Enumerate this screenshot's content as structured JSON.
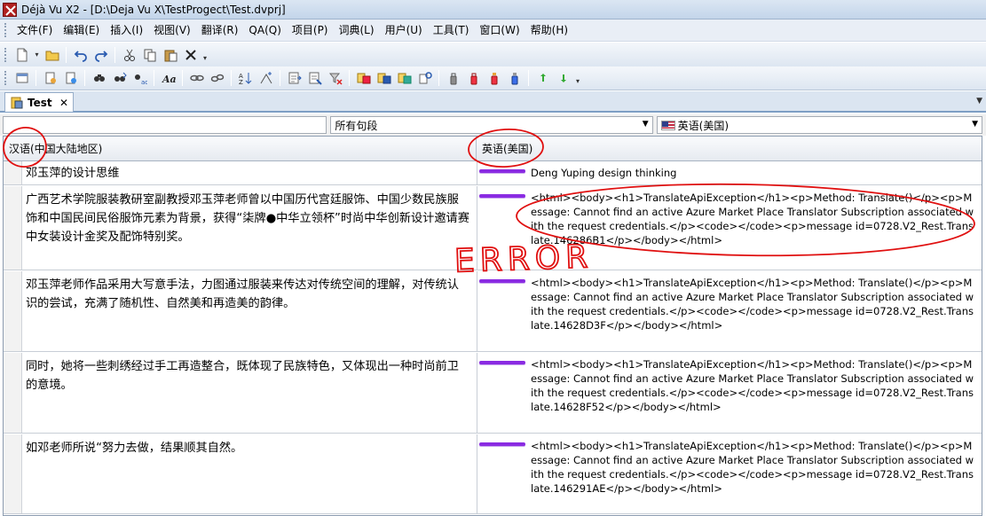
{
  "window": {
    "title": "Déjà Vu X2 - [D:\\Deja Vu X\\TestProgect\\Test.dvprj]"
  },
  "menu": [
    "文件(F)",
    "编辑(E)",
    "插入(I)",
    "视图(V)",
    "翻译(R)",
    "QA(Q)",
    "项目(P)",
    "词典(L)",
    "用户(U)",
    "工具(T)",
    "窗口(W)",
    "帮助(H)"
  ],
  "toolbar1_icons": [
    "new-file-icon",
    "open-folder-icon",
    "undo-icon",
    "redo-icon",
    "cut-icon",
    "copy-icon",
    "paste-icon",
    "delete-icon"
  ],
  "toolbar2_icons": [
    "project-properties-icon",
    "import-icon",
    "find-icon",
    "find-next-icon",
    "replace-icon",
    "font-icon",
    "link-icon",
    "unlink-icon",
    "sort-ascending-icon",
    "sort-descending-icon",
    "pretranslate-icon",
    "autotranslate-icon",
    "clear-filter-icon",
    "lookup-icon",
    "assemble-icon",
    "propagate-icon",
    "scan-icon",
    "lock-icon",
    "lock-all-icon",
    "unlock-icon",
    "unlock-all-icon",
    "next-segment-icon",
    "previous-segment-icon"
  ],
  "tab": {
    "label": "Test",
    "close": "✕"
  },
  "filters": {
    "search_value": "",
    "segment_filter": "所有句段",
    "language": "英语(美国)"
  },
  "grid": {
    "source_header": "汉语(中国大陆地区)",
    "target_header": "英语(美国)",
    "rows": [
      {
        "source": "邓玉萍的设计思维",
        "target": "Deng Yuping design thinking"
      },
      {
        "source": "广西艺术学院服装教研室副教授邓玉萍老师曾以中国历代宫廷服饰、中国少数民族服饰和中国民间民俗服饰元素为背景，获得“柒牌●中华立领杯”时尚中华创新设计邀请赛中女装设计金奖及配饰特别奖。",
        "target": "<html><body><h1>TranslateApiException</h1><p>Method: Translate()</p><p>Message: Cannot find an active Azure Market Place Translator Subscription associated with the request credentials.</p><code></code><p>message id=0728.V2_Rest.Translate.146286B1</p></body></html>"
      },
      {
        "source": "邓玉萍老师作品采用大写意手法，力图通过服装来传达对传统空间的理解，对传统认识的尝试，充满了随机性、自然美和再造美的韵律。",
        "target": "<html><body><h1>TranslateApiException</h1><p>Method: Translate()</p><p>Message: Cannot find an active Azure Market Place Translator Subscription associated with the request credentials.</p><code></code><p>message id=0728.V2_Rest.Translate.14628D3F</p></body></html>"
      },
      {
        "source": "同时，她将一些刺绣经过手工再造整合，既体现了民族特色，又体现出一种时尚前卫的意境。",
        "target": "<html><body><h1>TranslateApiException</h1><p>Method: Translate()</p><p>Message: Cannot find an active Azure Market Place Translator Subscription associated with the request credentials.</p><code></code><p>message id=0728.V2_Rest.Translate.14628F52</p></body></html>"
      },
      {
        "source": "如邓老师所说“努力去做，结果顺其自然。",
        "target": "<html><body><h1>TranslateApiException</h1><p>Method: Translate()</p><p>Message: Cannot find an active Azure Market Place Translator Subscription associated with the request credentials.</p><code></code><p>message id=0728.V2_Rest.Translate.146291AE</p></body></html>"
      }
    ]
  },
  "annotation": {
    "text": "ERROR",
    "color": "#e01010"
  }
}
